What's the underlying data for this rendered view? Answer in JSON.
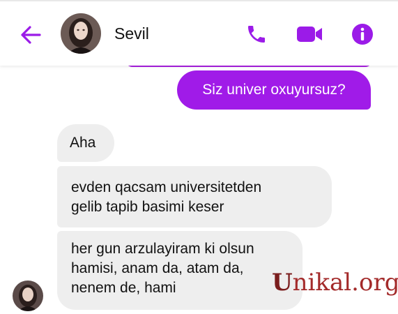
{
  "header": {
    "contact_name": "Sevil",
    "back_icon": "arrow-left-icon",
    "call_icon": "phone-icon",
    "video_icon": "video-camera-icon",
    "info_icon": "info-icon",
    "accent_color": "#9b1be8"
  },
  "messages": [
    {
      "direction": "sent",
      "text": "Siz univer oxuyursuz?"
    },
    {
      "direction": "received",
      "text": "Aha"
    },
    {
      "direction": "received",
      "text": "evden qacsam universitetden\ngelib tapib basimi keser"
    },
    {
      "direction": "received",
      "text": "her gun arzulayiram ki olsun\nhamisi, anam da, atam da,\nnenem de, hami"
    }
  ],
  "watermark": {
    "first_letter": "U",
    "rest": "nikal.org"
  }
}
